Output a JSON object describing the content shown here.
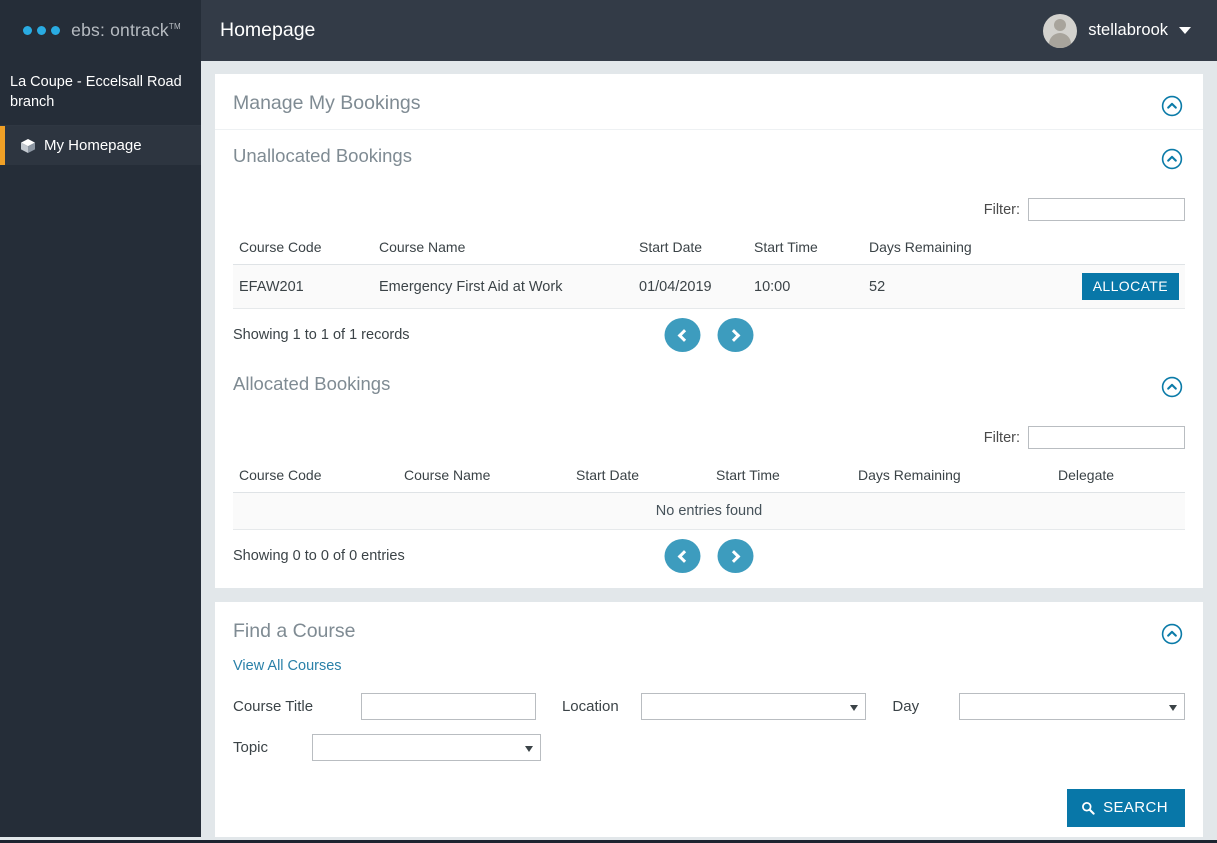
{
  "brand": {
    "logo_text": "ebs: ontrack",
    "logo_tm": "TM",
    "logo_icon": "three-dots-logo"
  },
  "header": {
    "page_title": "Homepage",
    "user_name": "stellabrook",
    "avatar_icon": "user-avatar",
    "caret_icon": "chevron-down-icon"
  },
  "sidebar": {
    "branch": "La Coupe - Eccelsall Road branch",
    "items": [
      {
        "label": "My Homepage",
        "icon": "cube-icon",
        "active": true
      }
    ]
  },
  "bookings_panel": {
    "title": "Manage My Bookings",
    "collapse_icon": "chevron-up-circle-icon",
    "unallocated": {
      "title": "Unallocated Bookings",
      "collapse_icon": "chevron-up-circle-icon",
      "filter_label": "Filter:",
      "filter_value": "",
      "filter_placeholder": "",
      "columns": [
        "Course Code",
        "Course Name",
        "Start Date",
        "Start Time",
        "Days Remaining",
        ""
      ],
      "rows": [
        {
          "course_code": "EFAW201",
          "course_name": "Emergency First Aid at Work",
          "start_date": "01/04/2019",
          "start_time": "10:00",
          "days_remaining": "52",
          "action_label": "ALLOCATE"
        }
      ],
      "showing": "Showing 1 to 1 of 1 records",
      "prev_icon": "chevron-left-icon",
      "next_icon": "chevron-right-icon"
    },
    "allocated": {
      "title": "Allocated Bookings",
      "collapse_icon": "chevron-up-circle-icon",
      "filter_label": "Filter:",
      "filter_value": "",
      "filter_placeholder": "",
      "columns": [
        "Course Code",
        "Course Name",
        "Start Date",
        "Start Time",
        "Days Remaining",
        "Delegate"
      ],
      "empty_message": "No entries found",
      "showing": "Showing 0 to 0 of 0 entries",
      "prev_icon": "chevron-left-icon",
      "next_icon": "chevron-right-icon"
    }
  },
  "find_course": {
    "title": "Find a Course",
    "collapse_icon": "chevron-up-circle-icon",
    "view_all_label": "View All Courses",
    "fields": {
      "course_title_label": "Course Title",
      "course_title_value": "",
      "course_title_placeholder": "",
      "location_label": "Location",
      "location_value": "",
      "day_label": "Day",
      "day_value": "",
      "topic_label": "Topic",
      "topic_value": ""
    },
    "search_label": "SEARCH",
    "search_icon": "magnifier-icon"
  },
  "colors": {
    "accent_blue": "#0877a8",
    "teal": "#3d9cbe",
    "logo_blue": "#29abe2",
    "sidebar_dark": "#252d38",
    "topbar_dark": "#333b47",
    "active_marker": "#f0a026",
    "page_bg": "#e2e7ea"
  }
}
